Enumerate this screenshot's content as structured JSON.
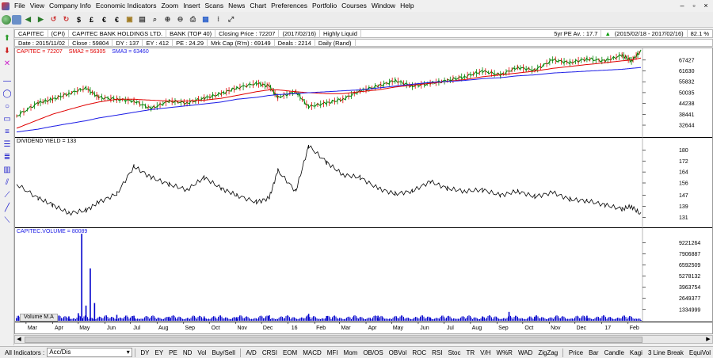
{
  "menu": [
    "File",
    "View",
    "Company Info",
    "Economic Indicators",
    "Zoom",
    "Insert",
    "Scans",
    "News",
    "Chart",
    "Preferences",
    "Portfolio",
    "Courses",
    "Window",
    "Help"
  ],
  "window_controls": [
    "–",
    "▫",
    "×"
  ],
  "toolbar_icons": [
    "globe-icon",
    "disk-icon",
    "back-icon",
    "forward-icon",
    "refresh-icon",
    "refresh2-icon",
    "dollar-icon",
    "pound-icon",
    "euro-icon",
    "euro2-icon",
    "lock-icon",
    "save-icon",
    "search-icon",
    "zoom-in-icon",
    "zoom-out-icon",
    "print-icon",
    "chart-icon",
    "dots-icon",
    "expand-icon"
  ],
  "toolbar_glyphs": {
    "dollar": "$",
    "pound": "£",
    "euro": "€"
  },
  "ticker": {
    "code": "CAPITEC",
    "symbol": "(CPI)",
    "name": "CAPITEC BANK HOLDINGS LTD.",
    "sector": "BANK (TOP 40)",
    "closing_price": "Closing Price : 72207",
    "closing_date": "(2017/02/16)",
    "liquidity": "Highly Liquid",
    "pe_avg": "5yr PE Av. : 17.7",
    "range": "(2015/02/18 - 2017/02/16)",
    "change_pct": "82.1 %",
    "up_arrow": "▲"
  },
  "info": {
    "date": "Date : 2015/11/02",
    "close": "Close : 59804",
    "dy": "DY : 137",
    "ey": "EY : 412",
    "pe": "PE : 24.29",
    "mkt_cap": "Mrk Cap (R'm) : 69149",
    "deals": "Deals : 2214",
    "period": "Daily (Rand)"
  },
  "legend": {
    "price": "CAPITEC = 72207",
    "sma2": "SMA2 = 56305",
    "sma3": "SMA3 = 63460",
    "dividend": "DIVIDEND YIELD = 133",
    "volume": "CAPITEC.VOLUME = 80089",
    "volume_ma": "Volume M.A"
  },
  "colors": {
    "price": "#008000",
    "sma2": "#e00000",
    "sma3": "#1a1ae6",
    "volume": "#0000cc",
    "divyield": "#000000",
    "grid": "#d0d0d0",
    "up_green": "#009900"
  },
  "price_axis": [
    "67427",
    "61630",
    "55832",
    "50035",
    "44238",
    "38441",
    "32644"
  ],
  "div_axis": [
    "180",
    "172",
    "164",
    "156",
    "147",
    "139",
    "131"
  ],
  "vol_axis": [
    "9221264",
    "7906887",
    "6592509",
    "5278132",
    "3963754",
    "2649377",
    "1334999"
  ],
  "x_axis": [
    "Mar",
    "Apr",
    "May",
    "Jun",
    "Jul",
    "Aug",
    "Sep",
    "Oct",
    "Nov",
    "Dec",
    "16",
    "Feb",
    "Mar",
    "Apr",
    "May",
    "Jun",
    "Jul",
    "Aug",
    "Sep",
    "Oct",
    "Nov",
    "Dec",
    "17",
    "Feb"
  ],
  "left_tools": [
    "up-arrow-icon",
    "down-arrow-icon",
    "delete-icon",
    "line-tool-icon",
    "ellipse-tool-icon",
    "circle-tool-icon",
    "box-tool-icon",
    "text-tool-icon",
    "fibonacci-tool-icon",
    "channel-tool-icon",
    "grid-tool-icon",
    "parallel-tool-icon",
    "fan-tool-icon",
    "trend-tool-icon",
    "diagonal-tool-icon"
  ],
  "bottom": {
    "all_indicators_label": "All Indicators :",
    "indicator_value": "Acc/Dis",
    "buttons": [
      "DY",
      "EY",
      "PE",
      "ND",
      "Vol",
      "Buy/Sell",
      "A/D",
      "CRSI",
      "EOM",
      "MACD",
      "MFI",
      "Mom",
      "OB/OS",
      "OBVol",
      "ROC",
      "RSI",
      "Stoc",
      "TR",
      "V/H",
      "W%R",
      "WAD",
      "ZigZag",
      "Price",
      "Bar",
      "Candle",
      "Kagi",
      "3 Line Break",
      "EquiVol"
    ]
  },
  "chart_data": [
    {
      "type": "line",
      "title": "",
      "ylabel": "",
      "ylim": [
        28000,
        72000
      ],
      "x": [
        "2015-02-18",
        "2015-03-15",
        "2015-04-01",
        "2015-04-20",
        "2015-05-10",
        "2015-05-25",
        "2015-06-15",
        "2015-07-05",
        "2015-07-25",
        "2015-08-15",
        "2015-09-05",
        "2015-09-25",
        "2015-10-15",
        "2015-11-02",
        "2015-11-25",
        "2015-12-10",
        "2015-12-20",
        "2016-01-10",
        "2016-01-25",
        "2016-02-15",
        "2016-03-05",
        "2016-03-25",
        "2016-04-15",
        "2016-05-05",
        "2016-05-25",
        "2016-06-15",
        "2016-07-05",
        "2016-07-25",
        "2016-08-15",
        "2016-09-05",
        "2016-09-25",
        "2016-10-15",
        "2016-11-05",
        "2016-11-25",
        "2016-12-15",
        "2017-01-05",
        "2017-01-25",
        "2017-02-05",
        "2017-02-16"
      ],
      "series": [
        {
          "name": "CAPITEC",
          "values": [
            37500,
            44500,
            46500,
            49500,
            52500,
            47500,
            46500,
            45500,
            41500,
            45500,
            44500,
            47000,
            49500,
            52500,
            55000,
            53500,
            47500,
            50500,
            42500,
            44500,
            46500,
            51000,
            53500,
            56500,
            53500,
            55000,
            56500,
            58500,
            61500,
            59500,
            63500,
            62000,
            67500,
            66000,
            68000,
            67000,
            70000,
            67000,
            72207
          ]
        },
        {
          "name": "SMA2",
          "values": [
            31000,
            35500,
            38500,
            41000,
            43500,
            45000,
            46500,
            46500,
            46000,
            45500,
            45500,
            46000,
            47000,
            48500,
            50500,
            51500,
            51500,
            50500,
            50000,
            49500,
            49500,
            50500,
            51500,
            53000,
            54000,
            55000,
            56000,
            57000,
            58500,
            59500,
            60500,
            61500,
            63000,
            64000,
            65000,
            66000,
            67000,
            67500,
            68500
          ]
        },
        {
          "name": "SMA3",
          "values": [
            29000,
            30500,
            32000,
            33500,
            35000,
            36500,
            38000,
            39500,
            41000,
            42000,
            43000,
            44000,
            45000,
            46500,
            47500,
            48500,
            49000,
            49500,
            50000,
            50500,
            51000,
            51500,
            52500,
            53500,
            54500,
            55500,
            56000,
            56500,
            57500,
            58000,
            59000,
            59500,
            60500,
            61000,
            61500,
            62000,
            62500,
            63000,
            63460
          ]
        }
      ]
    },
    {
      "type": "line",
      "title": "",
      "ylim": [
        126,
        186
      ],
      "x": [
        "2015-02-18",
        "2015-03-15",
        "2015-04-01",
        "2015-04-20",
        "2015-05-10",
        "2015-05-25",
        "2015-06-15",
        "2015-07-05",
        "2015-07-25",
        "2015-08-15",
        "2015-09-05",
        "2015-09-25",
        "2015-10-15",
        "2015-11-02",
        "2015-11-25",
        "2015-12-10",
        "2015-12-20",
        "2016-01-10",
        "2016-01-25",
        "2016-02-15",
        "2016-03-05",
        "2016-03-25",
        "2016-04-15",
        "2016-05-05",
        "2016-05-25",
        "2016-06-15",
        "2016-07-05",
        "2016-07-25",
        "2016-08-15",
        "2016-09-05",
        "2016-09-25",
        "2016-10-15",
        "2016-11-05",
        "2016-11-25",
        "2016-12-15",
        "2017-01-05",
        "2017-01-25",
        "2017-02-05",
        "2017-02-16"
      ],
      "series": [
        {
          "name": "DIVIDEND YIELD",
          "values": [
            155,
            145,
            140,
            134,
            136,
            142,
            148,
            168,
            160,
            155,
            151,
            160,
            152,
            147,
            142,
            145,
            165,
            150,
            183,
            171,
            162,
            160,
            152,
            148,
            150,
            157,
            152,
            150,
            151,
            147,
            150,
            146,
            149,
            144,
            143,
            140,
            137,
            139,
            133
          ]
        }
      ]
    },
    {
      "type": "bar",
      "title": "",
      "ylim": [
        0,
        10500000
      ],
      "x": [
        "2015-02-18",
        "2015-03-15",
        "2015-04-01",
        "2015-04-20",
        "2015-05-01",
        "2015-05-05",
        "2015-05-10",
        "2015-05-15",
        "2015-05-20",
        "2015-06-15",
        "2015-07-05",
        "2015-08-15",
        "2015-09-25",
        "2015-11-02",
        "2015-12-10",
        "2016-01-25",
        "2016-02-15",
        "2016-04-15",
        "2016-06-15",
        "2016-08-15",
        "2016-09-15",
        "2016-10-15",
        "2016-12-15",
        "2017-02-16"
      ],
      "series": [
        {
          "name": "CAPITEC.VOLUME",
          "values": [
            320000,
            450000,
            380000,
            520000,
            900000,
            10300000,
            1800000,
            6200000,
            2100000,
            700000,
            600000,
            480000,
            520000,
            430000,
            650000,
            820000,
            560000,
            600000,
            400000,
            520000,
            1050000,
            480000,
            600000,
            80089
          ]
        }
      ]
    }
  ]
}
